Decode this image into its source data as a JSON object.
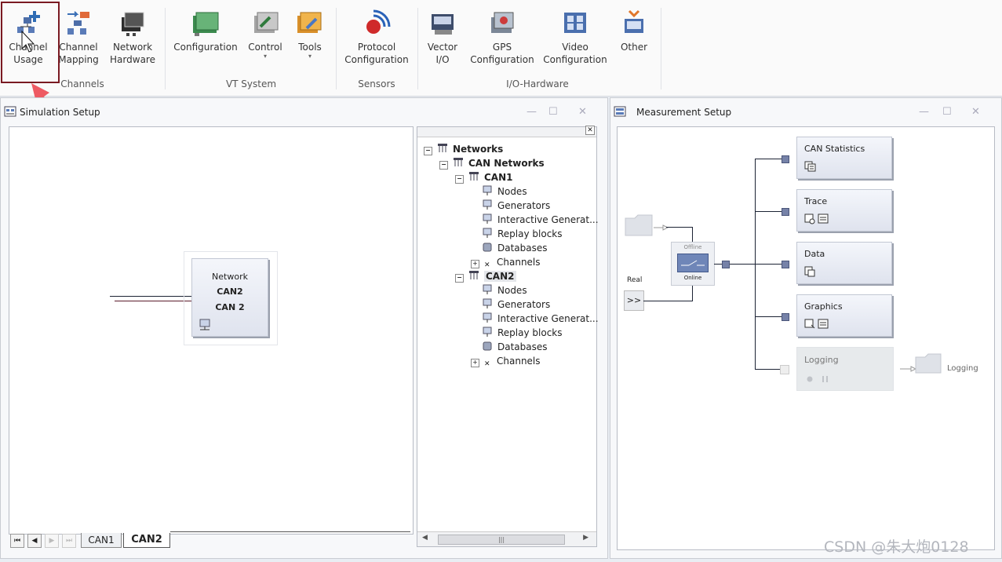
{
  "ribbon": {
    "buttons": [
      {
        "id": "channel-usage",
        "label": "Channel\nUsage",
        "icon": "channel-usage-icon",
        "dropdown": false,
        "selected": true
      },
      {
        "id": "channel-mapping",
        "label": "Channel\nMapping",
        "icon": "channel-mapping-icon",
        "dropdown": false
      },
      {
        "id": "network-hardware",
        "label": "Network\nHardware",
        "icon": "network-hardware-icon",
        "dropdown": false
      },
      {
        "id": "configuration",
        "label": "Configuration",
        "icon": "configuration-icon",
        "dropdown": false
      },
      {
        "id": "control",
        "label": "Control",
        "icon": "control-icon",
        "dropdown": true
      },
      {
        "id": "tools",
        "label": "Tools",
        "icon": "tools-icon",
        "dropdown": true
      },
      {
        "id": "protocol-configuration",
        "label": "Protocol\nConfiguration",
        "icon": "protocol-configuration-icon",
        "dropdown": false
      },
      {
        "id": "vector-io",
        "label": "Vector\nI/O",
        "icon": "vector-io-icon",
        "dropdown": false
      },
      {
        "id": "gps-configuration",
        "label": "GPS\nConfiguration",
        "icon": "gps-configuration-icon",
        "dropdown": false
      },
      {
        "id": "video-configuration",
        "label": "Video\nConfiguration",
        "icon": "video-configuration-icon",
        "dropdown": false
      },
      {
        "id": "other",
        "label": "Other",
        "icon": "other-icon",
        "dropdown": false
      }
    ],
    "groups": [
      "Channels",
      "VT System",
      "Sensors",
      "I/O-Hardware"
    ],
    "dropdown_glyph": "▾"
  },
  "simulation": {
    "title": "Simulation Setup",
    "network_box": {
      "title": "Network",
      "line1": "CAN2",
      "line2": "CAN 2"
    },
    "tabs": [
      "CAN1",
      "CAN2"
    ],
    "active_tab": "CAN2",
    "nav_glyphs": [
      "⏮",
      "◀",
      "▶",
      "⏭"
    ],
    "tree": {
      "root": "Networks",
      "can_networks": "CAN Networks",
      "networks": [
        {
          "name": "CAN1",
          "children": [
            "Nodes",
            "Generators",
            "Interactive Generat...",
            "Replay blocks",
            "Databases",
            "Channels"
          ]
        },
        {
          "name": "CAN2",
          "children": [
            "Nodes",
            "Generators",
            "Interactive Generat...",
            "Replay blocks",
            "Databases",
            "Channels"
          ]
        }
      ],
      "close_glyph": "✕",
      "scroll_glyphs": [
        "◀",
        "|||",
        "▶"
      ]
    }
  },
  "measurement": {
    "title": "Measurement Setup",
    "switch": {
      "top": "Offline",
      "bottom": "Online"
    },
    "real_label": "Real",
    "real_button": ">>",
    "blocks": [
      {
        "label": "CAN Statistics",
        "enabled": true
      },
      {
        "label": "Trace",
        "enabled": true
      },
      {
        "label": "Data",
        "enabled": true
      },
      {
        "label": "Graphics",
        "enabled": true
      },
      {
        "label": "Logging",
        "enabled": false
      }
    ],
    "logging_output": "Logging"
  },
  "window_controls": {
    "minimize": "—",
    "maximize": "☐",
    "close": "✕"
  },
  "watermark": "CSDN @朱大炮0128",
  "colors": {
    "highlight_border": "#7a1a22",
    "arrow": "#ee5a63",
    "connector": "#7682a8"
  }
}
